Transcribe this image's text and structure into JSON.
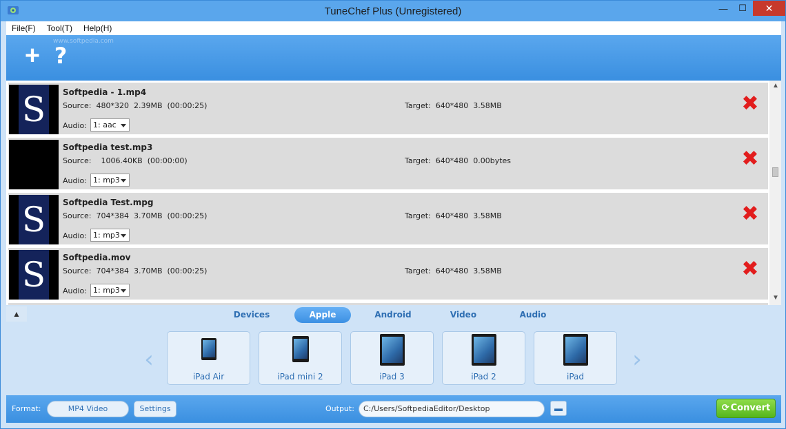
{
  "window": {
    "title": "TuneChef Plus (Unregistered)",
    "minimize": "—",
    "maximize": "☐",
    "close": "✕"
  },
  "menu": {
    "file": "File(F)",
    "tool": "Tool(T)",
    "help": "Help(H)"
  },
  "toolbar": {
    "watermark": "www.softpedia.com",
    "add_icon": "+",
    "help_icon": "?"
  },
  "files": [
    {
      "name": "Softpedia - 1.mp4",
      "source": "Source:  480*320  2.39MB  (00:00:25)",
      "target": "Target:  640*480  3.58MB",
      "audio_label": "Audio:",
      "audio_value": "1: aac",
      "thumb": "S"
    },
    {
      "name": "Softpedia test.mp3",
      "source": "Source:    1006.40KB  (00:00:00)",
      "target": "Target:  640*480  0.00bytes",
      "audio_label": "Audio:",
      "audio_value": "1: mp3",
      "thumb": ""
    },
    {
      "name": "Softpedia Test.mpg",
      "source": "Source:  704*384  3.70MB  (00:00:25)",
      "target": "Target:  640*480  3.58MB",
      "audio_label": "Audio:",
      "audio_value": "1: mp3",
      "thumb": "S"
    },
    {
      "name": "Softpedia.mov",
      "source": "Source:  704*384  3.70MB  (00:00:25)",
      "target": "Target:  640*480  3.58MB",
      "audio_label": "Audio:",
      "audio_value": "1: mp3",
      "thumb": "S"
    }
  ],
  "delete_icon": "✖",
  "scrollbar": {
    "up": "▲",
    "down": "▼"
  },
  "collapse_icon": "▲",
  "tabs": {
    "devices": "Devices",
    "apple": "Apple",
    "android": "Android",
    "video": "Video",
    "audio": "Audio"
  },
  "carousel": {
    "prev": "‹",
    "next": "›",
    "devices": [
      "iPad Air",
      "iPad mini 2",
      "iPad 3",
      "iPad 2",
      "iPad"
    ]
  },
  "bottom": {
    "format_label": "Format:",
    "format_value": "MP4 Video",
    "settings": "Settings",
    "output_label": "Output:",
    "output_path": "C:/Users/SoftpediaEditor/Desktop",
    "folder_icon": "▬",
    "convert": "Convert",
    "convert_icon": "⟳"
  },
  "colors": {
    "accent": "#3c90e3",
    "delete": "#e21d1d",
    "convert": "#55b61d"
  }
}
